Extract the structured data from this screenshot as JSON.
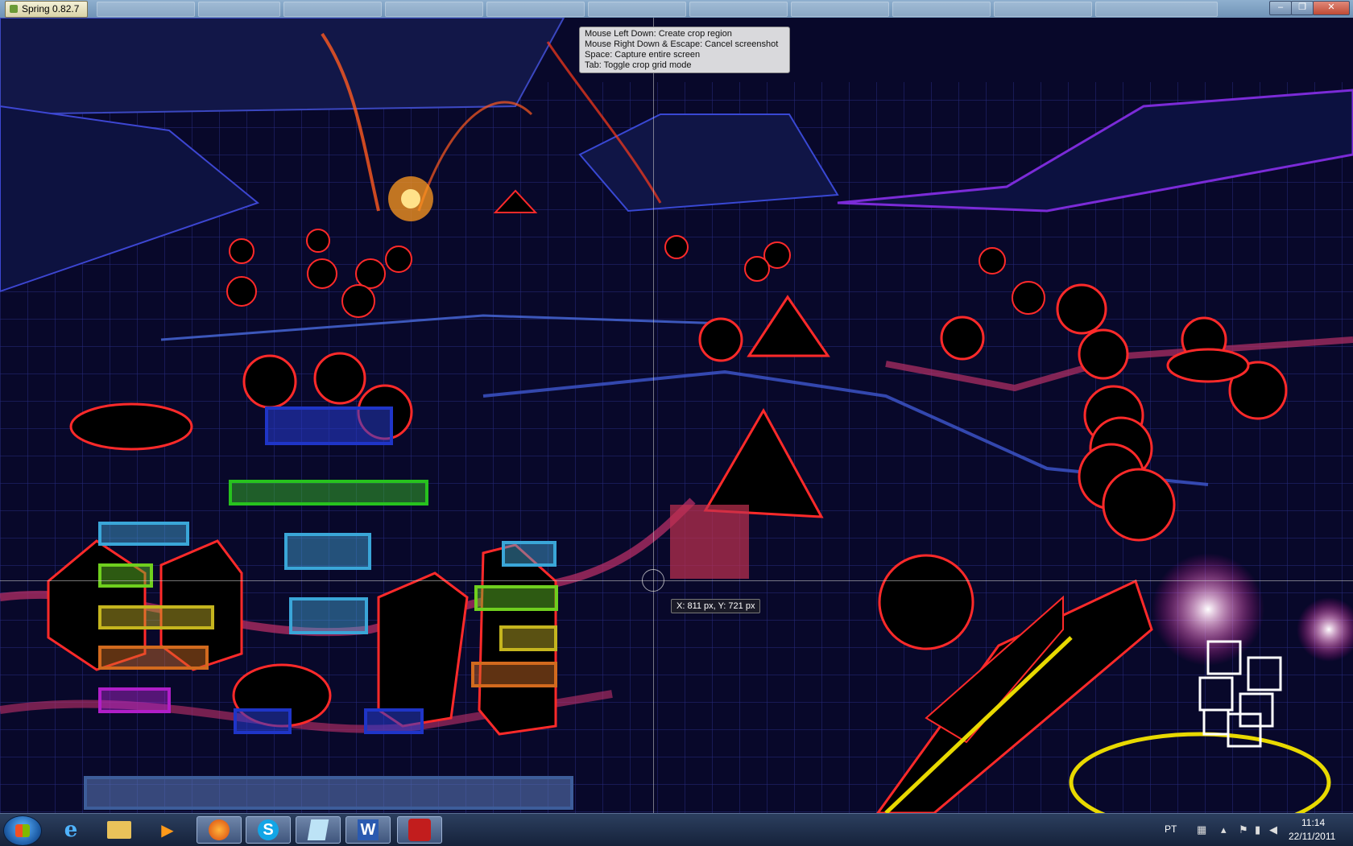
{
  "window": {
    "title": "Spring 0.82.7"
  },
  "screenshot_tool": {
    "help_lines": [
      "Mouse Left Down: Create crop region",
      "Mouse Right Down & Escape: Cancel screenshot",
      "Space: Capture entire screen",
      "Tab: Toggle crop grid mode"
    ],
    "coordinate_readout": "X: 811 px, Y: 721 px"
  },
  "taskbar": {
    "language": "PT",
    "time": "11:14",
    "date": "22/11/2011",
    "apps": [
      {
        "name": "start-button"
      },
      {
        "name": "internet-explorer-icon"
      },
      {
        "name": "file-explorer-icon"
      },
      {
        "name": "media-player-icon"
      },
      {
        "name": "firefox-icon"
      },
      {
        "name": "skype-icon"
      },
      {
        "name": "notepad-icon"
      },
      {
        "name": "word-icon"
      },
      {
        "name": "spring-game-icon"
      }
    ]
  },
  "colors": {
    "scene_bg": "#05051a",
    "grid_blue": "#3845b8",
    "unit_red": "#ff2a2a",
    "taskbar": "#1c2b47"
  }
}
